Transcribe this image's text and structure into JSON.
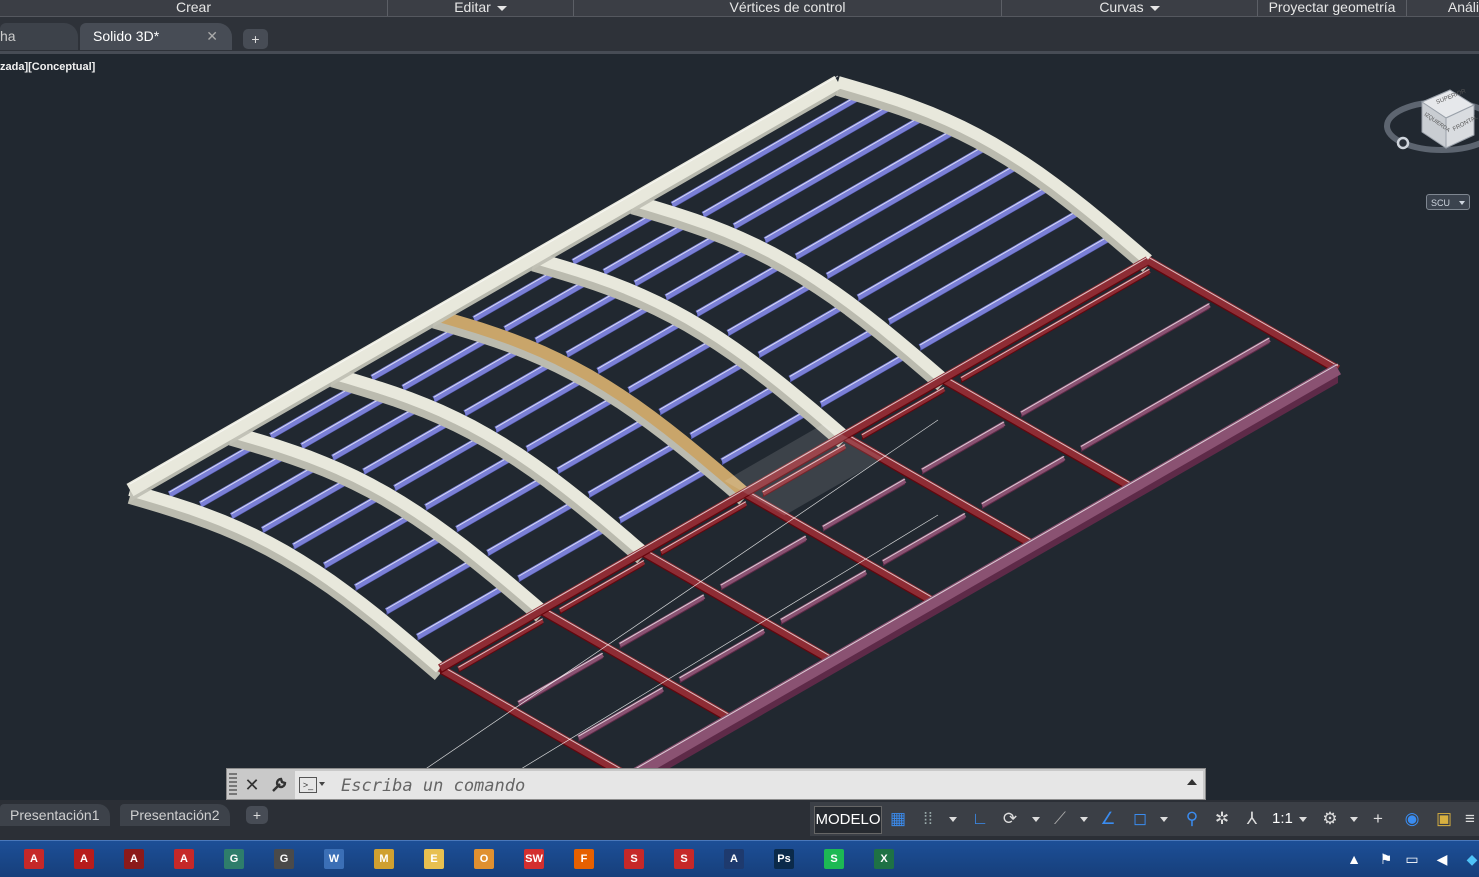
{
  "ribbon": {
    "panels": [
      {
        "label": "Crear",
        "dropdown": false
      },
      {
        "label": "Editar",
        "dropdown": true
      },
      {
        "label": "Vértices de control",
        "dropdown": false
      },
      {
        "label": "Curvas",
        "dropdown": true
      },
      {
        "label": "Proyectar geometría",
        "dropdown": false
      },
      {
        "label": "Análi",
        "dropdown": false
      }
    ]
  },
  "file_tabs": {
    "items": [
      {
        "label": "ha",
        "active": false
      },
      {
        "label": "Solido 3D*",
        "active": true
      }
    ],
    "close_glyph": "✕",
    "new_glyph": "+"
  },
  "viewport": {
    "label": "zada][Conceptual]",
    "viewcube": {
      "top": "SUPERIOR",
      "front": "FRONTAL",
      "left": "IZQUIERDA"
    },
    "ucs_label": "SCU"
  },
  "command_line": {
    "placeholder": "Escriba un comando",
    "close_glyph": "✕",
    "prompt_glyph": ">_"
  },
  "layout_tabs": {
    "items": [
      "Presentación1",
      "Presentación2"
    ],
    "add_glyph": "+"
  },
  "status_bar": {
    "model_label": "MODELO",
    "annotation_scale": "1:1"
  },
  "taskbar": {
    "apps": [
      {
        "name": "acrobat-reader",
        "color": "#c62828",
        "glyph": "A"
      },
      {
        "name": "acrobat",
        "color": "#b71c1c",
        "glyph": "A"
      },
      {
        "name": "autodesk-app",
        "color": "#8b1a1a",
        "glyph": "A"
      },
      {
        "name": "autocad",
        "color": "#c62828",
        "glyph": "A"
      },
      {
        "name": "app-spiral-1",
        "color": "#2e7d6b",
        "glyph": "G"
      },
      {
        "name": "app-spiral-2",
        "color": "#4a4a4a",
        "glyph": "G"
      },
      {
        "name": "window-app",
        "color": "#3b6fb6",
        "glyph": "W"
      },
      {
        "name": "media-app",
        "color": "#d0a030",
        "glyph": "M"
      },
      {
        "name": "file-explorer",
        "color": "#e8c050",
        "glyph": "E"
      },
      {
        "name": "outlook",
        "color": "#e09030",
        "glyph": "O"
      },
      {
        "name": "solidworks",
        "color": "#d32f2f",
        "glyph": "SW"
      },
      {
        "name": "firefox",
        "color": "#e66000",
        "glyph": "F"
      },
      {
        "name": "sketchup-1",
        "color": "#c62828",
        "glyph": "S"
      },
      {
        "name": "sketchup-2",
        "color": "#c62828",
        "glyph": "S"
      },
      {
        "name": "autodesk-a",
        "color": "#1e3a6e",
        "glyph": "A"
      },
      {
        "name": "photoshop",
        "color": "#0b2a4a",
        "glyph": "Ps"
      },
      {
        "name": "spotify",
        "color": "#1db954",
        "glyph": "S"
      },
      {
        "name": "excel",
        "color": "#1e7145",
        "glyph": "X"
      }
    ]
  }
}
